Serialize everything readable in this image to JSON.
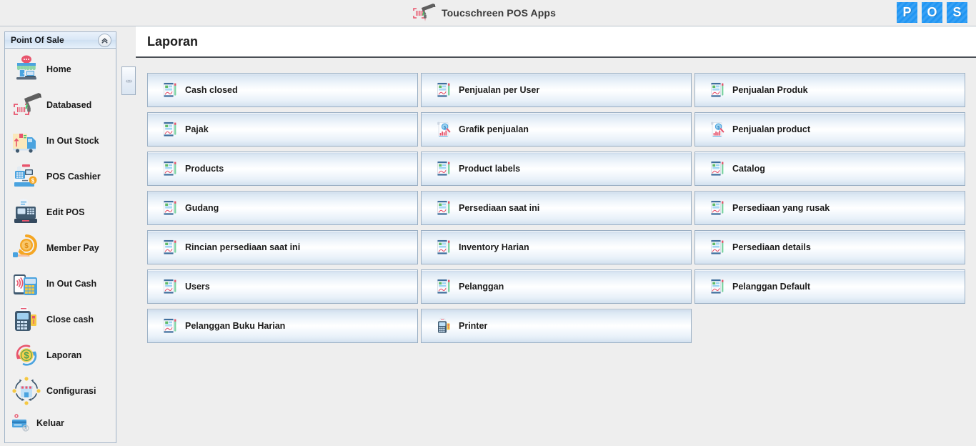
{
  "app": {
    "title": "Toucschreen POS Apps",
    "brand_icon": "barcode-scanner-icon",
    "badges": [
      "P",
      "O",
      "S"
    ],
    "accent_color": "#2196f3",
    "panel_border_color": "#a3b5c9"
  },
  "sidebar": {
    "header": "Point Of Sale",
    "collapse_icon": "double-chevron-up-icon",
    "items": [
      {
        "label": "Home",
        "icon": "storefront-icon"
      },
      {
        "label": "Databased",
        "icon": "barcode-scanner-icon"
      },
      {
        "label": "In Out Stock",
        "icon": "delivery-truck-icon"
      },
      {
        "label": "POS Cashier",
        "icon": "cash-register-icon"
      },
      {
        "label": "Edit POS",
        "icon": "pos-terminal-icon"
      },
      {
        "label": "Member Pay",
        "icon": "coin-hand-icon"
      },
      {
        "label": "In Out Cash",
        "icon": "contactless-payment-icon"
      },
      {
        "label": "Close cash",
        "icon": "card-terminal-icon"
      },
      {
        "label": "Laporan",
        "icon": "money-refresh-icon"
      },
      {
        "label": "Configurasi",
        "icon": "shop-settings-icon"
      },
      {
        "label": "Keluar",
        "icon": "logout-card-icon"
      }
    ]
  },
  "splitter": {
    "icon": "collapse-panel-icon",
    "glyph": "«»"
  },
  "main": {
    "page_title": "Laporan",
    "reports": [
      {
        "label": "Cash closed",
        "icon": "report-document-icon"
      },
      {
        "label": "Penjualan per User",
        "icon": "report-document-icon"
      },
      {
        "label": "Penjualan Produk",
        "icon": "report-document-icon"
      },
      {
        "label": "Pajak",
        "icon": "report-document-icon"
      },
      {
        "label": "Grafik penjualan",
        "icon": "chart-search-icon"
      },
      {
        "label": "Penjualan product",
        "icon": "chart-search-icon"
      },
      {
        "label": "Products",
        "icon": "report-document-icon"
      },
      {
        "label": "Product labels",
        "icon": "report-document-icon"
      },
      {
        "label": "Catalog",
        "icon": "report-document-icon"
      },
      {
        "label": "Gudang",
        "icon": "report-document-icon"
      },
      {
        "label": "Persediaan saat ini",
        "icon": "report-document-icon"
      },
      {
        "label": "Persediaan yang rusak",
        "icon": "report-document-icon"
      },
      {
        "label": "Rincian persediaan saat ini",
        "icon": "report-document-icon"
      },
      {
        "label": "Inventory Harian",
        "icon": "report-document-icon"
      },
      {
        "label": "Persediaan details",
        "icon": "report-document-icon"
      },
      {
        "label": "Users",
        "icon": "report-document-icon"
      },
      {
        "label": "Pelanggan",
        "icon": "report-document-icon"
      },
      {
        "label": "Pelanggan Default",
        "icon": "report-document-icon"
      },
      {
        "label": "Pelanggan Buku Harian",
        "icon": "report-document-icon"
      },
      {
        "label": "Printer",
        "icon": "printer-terminal-icon"
      }
    ]
  }
}
